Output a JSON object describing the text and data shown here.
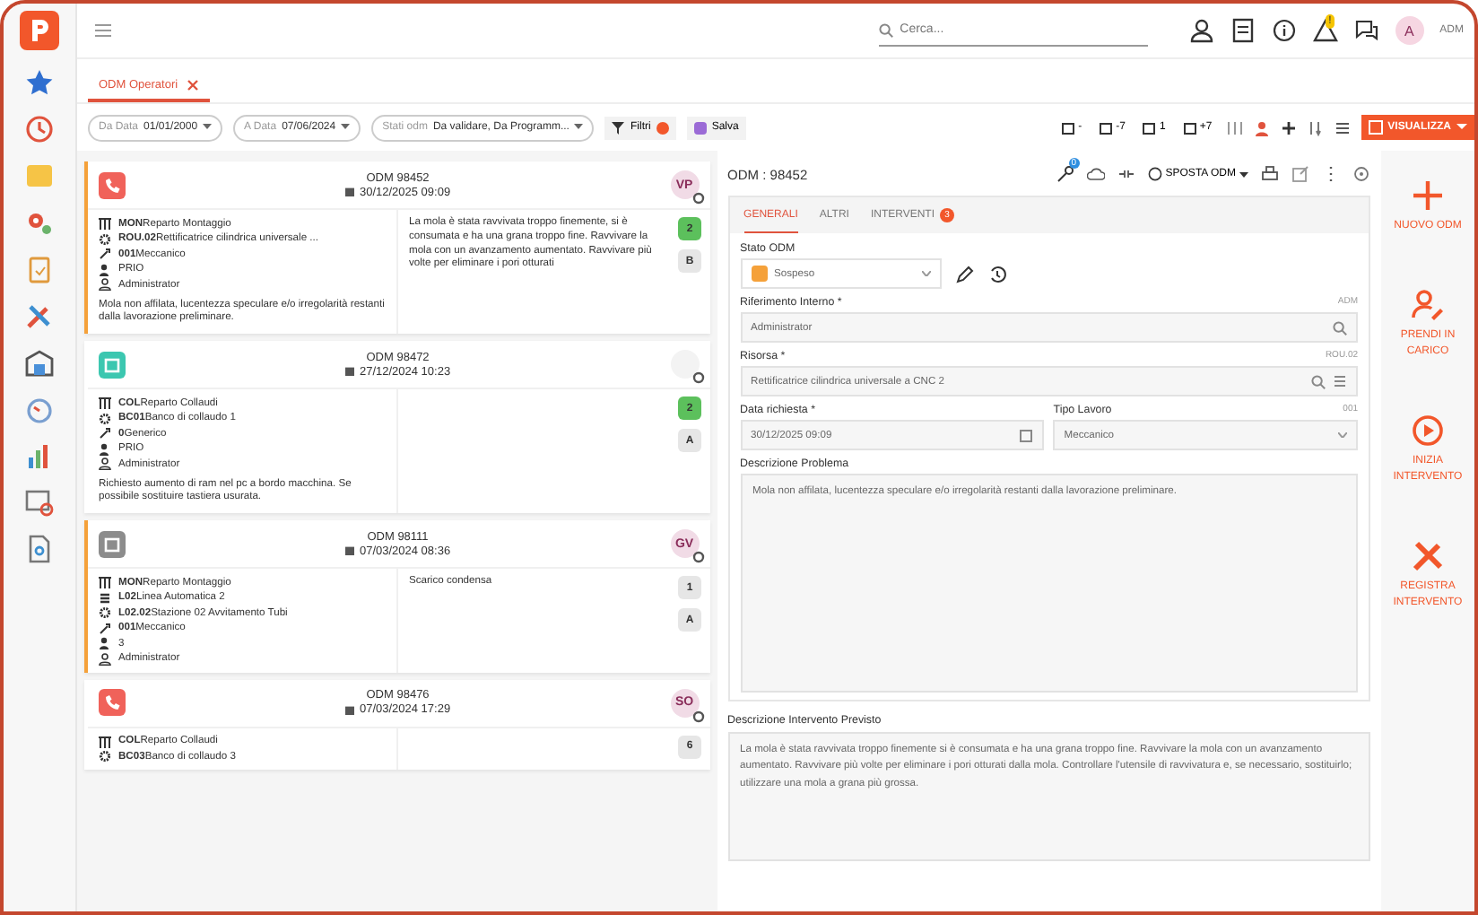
{
  "topbar": {
    "search": {
      "placeholder": "Cerca..."
    },
    "avatar": "A",
    "user": "ADM",
    "alert_badge": "!"
  },
  "tabs": [
    {
      "label": "ODM Operatori",
      "selected": true
    }
  ],
  "filters": {
    "chips": [
      {
        "label": "Da Data",
        "value": "01/01/2000"
      },
      {
        "label": "A Data",
        "value": "07/06/2024"
      },
      {
        "label": "Stati odm",
        "value": "Da validare, Da Programm..."
      }
    ],
    "filter_button": "Filtri",
    "salva_button": "Salva",
    "date_buttons": [
      "-",
      "-7",
      "1",
      "+7"
    ],
    "view_button": "VISUALIZZA"
  },
  "cards": [
    {
      "flagged": true,
      "kind": "phone",
      "color": "#f0625a",
      "title": "ODM 98452",
      "date": "30/12/2025 09:09",
      "assignee": "VP",
      "lines": [
        {
          "kind": "department",
          "code": "MON",
          "text": "Reparto Montaggio"
        },
        {
          "kind": "machine",
          "code": "ROU.02",
          "text": "Rettificatrice cilindrica universale ..."
        },
        {
          "kind": "skill",
          "code": "001",
          "text": "Meccanico"
        },
        {
          "kind": "priority",
          "text": "PRIO"
        },
        {
          "kind": "user",
          "text": "Administrator"
        }
      ],
      "description": "Mola non affilata, lucentezza speculare e/o irregolarità restanti dalla lavorazione preliminare.",
      "note": "La mola è stata ravvivata troppo finemente, si è consumata e ha una grana troppo fine. Ravvivare la mola con un avanzamento aumentato. Ravvivare più volte per eliminare i pori otturati",
      "badges": [
        {
          "label": "2",
          "color": "#5cc05c"
        },
        {
          "label": "B",
          "color": "#e6e6e6"
        }
      ]
    },
    {
      "flagged": false,
      "kind": "calendar",
      "color": "#3cc7b0",
      "title": "ODM 98472",
      "date": "27/12/2024 10:23",
      "lines": [
        {
          "kind": "department",
          "code": "COL",
          "text": "Reparto Collaudi"
        },
        {
          "kind": "machine",
          "code": "BC01",
          "text": "Banco di collaudo 1"
        },
        {
          "kind": "skill",
          "code": "0",
          "text": "Generico"
        },
        {
          "kind": "priority",
          "text": "PRIO"
        },
        {
          "kind": "user",
          "text": "Administrator"
        }
      ],
      "description": "Richiesto aumento di ram nel pc a bordo macchina. Se possibile sostituire tastiera usurata.",
      "badges": [
        {
          "label": "2",
          "color": "#5cc05c"
        },
        {
          "label": "A",
          "color": "#e6e6e6"
        }
      ]
    },
    {
      "flagged": true,
      "kind": "calendar",
      "color": "#8c8c8c",
      "title": "ODM 98111",
      "date": "07/03/2024 08:36",
      "assignee": "GV",
      "lines": [
        {
          "kind": "department",
          "code": "MON",
          "text": "Reparto Montaggio"
        },
        {
          "kind": "line",
          "code": "L02",
          "text": "Linea Automatica 2"
        },
        {
          "kind": "machine",
          "code": "L02.02",
          "text": "Stazione 02 Avvitamento Tubi"
        },
        {
          "kind": "skill",
          "code": "001",
          "text": "Meccanico"
        },
        {
          "kind": "priority",
          "text": "3"
        },
        {
          "kind": "user",
          "text": "Administrator"
        }
      ],
      "note": "Scarico condensa",
      "badges": [
        {
          "label": "1",
          "color": "#e6e6e6"
        },
        {
          "label": "A",
          "color": "#e6e6e6"
        }
      ]
    },
    {
      "flagged": false,
      "kind": "phone",
      "color": "#f0625a",
      "title": "ODM 98476",
      "date": "07/03/2024 17:29",
      "assignee": "SO",
      "lines": [
        {
          "kind": "department",
          "code": "COL",
          "text": "Reparto Collaudi"
        },
        {
          "kind": "machine",
          "code": "BC03",
          "text": "Banco di collaudo 3"
        }
      ],
      "badges": [
        {
          "label": "6",
          "color": "#e6e6e6"
        }
      ]
    }
  ],
  "detail": {
    "title": "ODM : 98452",
    "key_badge": "0",
    "move_button": "SPOSTA ODM",
    "tabs": [
      {
        "label": "GENERALI",
        "selected": true
      },
      {
        "label": "ALTRI",
        "selected": false
      },
      {
        "label": "INTERVENTI",
        "selected": false,
        "badge": "3"
      }
    ],
    "status": {
      "label": "Stato ODM",
      "value": "Sospeso",
      "color": "#f5a13a"
    },
    "riferimento": {
      "label": "Riferimento Interno *",
      "code": "ADM",
      "value": "Administrator"
    },
    "risorsa": {
      "label": "Risorsa *",
      "code": "ROU.02",
      "value": "Rettificatrice cilindrica universale a CNC 2"
    },
    "data": {
      "label": "Data richiesta *",
      "value": "30/12/2025 09:09"
    },
    "tipo": {
      "label": "Tipo Lavoro",
      "code": "001",
      "value": "Meccanico"
    },
    "problema": {
      "label": "Descrizione Problema",
      "value": "Mola non affilata, lucentezza speculare e/o irregolarità restanti dalla lavorazione preliminare."
    },
    "intervento": {
      "label": "Descrizione Intervento Previsto",
      "value": "La mola è stata ravvivata troppo finemente si è consumata e ha una grana troppo fine. Ravvivare la mola con un avanzamento aumentato. Ravvivare più volte per eliminare i pori otturati dalla mola. Controllare l'utensile di ravvivatura e, se necessario, sostituirlo; utilizzare una mola a grana più grossa."
    }
  },
  "actions": [
    {
      "kind": "new",
      "label": "NUOVO ODM"
    },
    {
      "kind": "take",
      "label": "PRENDI IN CARICO"
    },
    {
      "kind": "start",
      "label": "INIZIA INTERVENTO"
    },
    {
      "kind": "register",
      "label": "REGISTRA INTERVENTO"
    }
  ]
}
